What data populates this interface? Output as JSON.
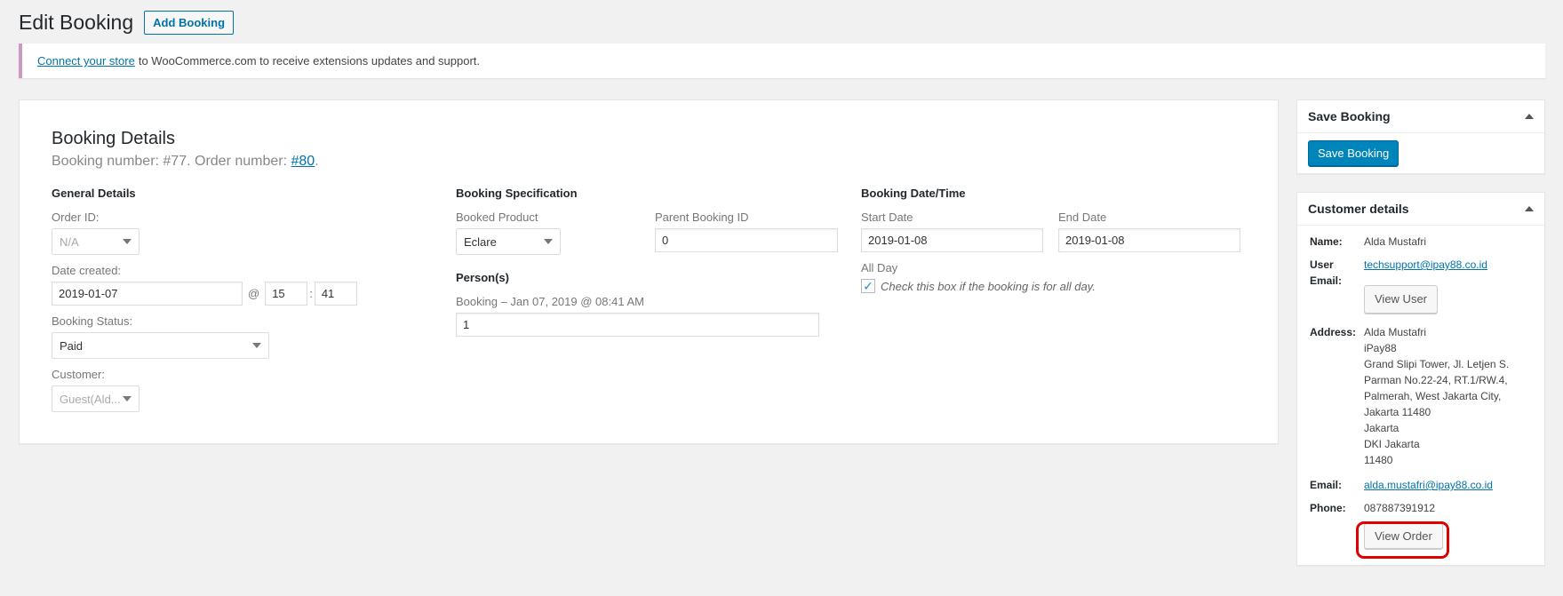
{
  "header": {
    "title": "Edit Booking",
    "add_label": "Add Booking"
  },
  "notice": {
    "link": "Connect your store",
    "text": "to WooCommerce.com to receive extensions updates and support."
  },
  "booking": {
    "title": "Booking Details",
    "sub_prefix": "Booking number: #77. Order number: ",
    "order_link": "#80",
    "sub_suffix": ".",
    "general": {
      "heading": "General Details",
      "order_id_label": "Order ID:",
      "order_id_value": "N/A",
      "date_created_label": "Date created:",
      "date_value": "2019-01-07",
      "at": "@",
      "hour": "15",
      "colon": ":",
      "minute": "41",
      "status_label": "Booking Status:",
      "status_value": "Paid",
      "customer_label": "Customer:",
      "customer_value": "Guest(Ald..."
    },
    "spec": {
      "heading": "Booking Specification",
      "product_label": "Booked Product",
      "product_value": "Eclare",
      "parent_label": "Parent Booking ID",
      "parent_value": "0",
      "persons_heading": "Person(s)",
      "persons_label": "Booking – Jan 07, 2019 @ 08:41 AM",
      "persons_value": "1"
    },
    "datetime": {
      "heading": "Booking Date/Time",
      "start_label": "Start Date",
      "start_value": "2019-01-08",
      "end_label": "End Date",
      "end_value": "2019-01-08",
      "allday_label": "All Day",
      "allday_text": "Check this box if the booking is for all day."
    }
  },
  "save_box": {
    "title": "Save Booking",
    "button": "Save Booking"
  },
  "customer": {
    "title": "Customer details",
    "name_key": "Name:",
    "name_val": "Alda Mustafri",
    "user_email_key": "User Email:",
    "user_email_val": "techsupport@ipay88.co.id",
    "view_user": "View User",
    "address_key": "Address:",
    "address_lines": [
      "Alda Mustafri",
      "iPay88",
      "Grand Slipi Tower, Jl. Letjen S.",
      "Parman No.22-24, RT.1/RW.4,",
      "Palmerah, West Jakarta City,",
      "Jakarta 11480",
      "Jakarta",
      "DKI Jakarta",
      "11480"
    ],
    "email_key": "Email:",
    "email_val": "alda.mustafri@ipay88.co.id",
    "phone_key": "Phone:",
    "phone_val": "087887391912",
    "view_order": "View Order"
  },
  "colors": {
    "accent": "#0085ba",
    "link": "#0073aa",
    "highlight": "#e00000"
  }
}
